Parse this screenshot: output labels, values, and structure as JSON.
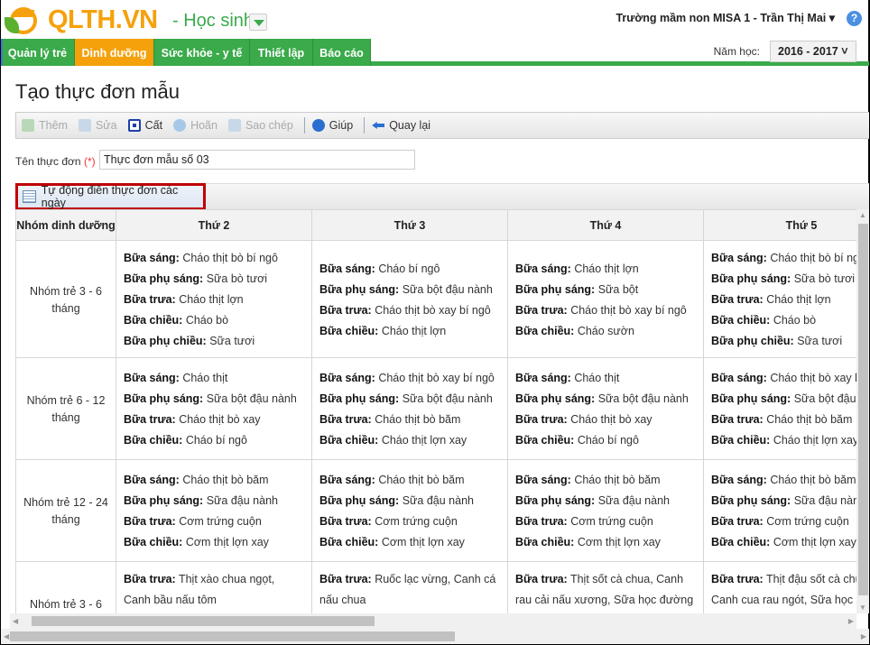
{
  "header": {
    "logo": "QLTH.VN",
    "role": "- Học sinh",
    "user": "Trường mầm non MISA 1 - Trần Thị Mai ▾",
    "help": "?"
  },
  "nav": {
    "tabs": [
      "Quản lý trẻ",
      "Dinh dưỡng",
      "Sức khỏe - y tế",
      "Thiết lập",
      "Báo cáo"
    ],
    "active": 1,
    "year_label": "Năm học:",
    "year_value": "2016 - 2017 ˅"
  },
  "page": {
    "title": "Tạo thực đơn mẫu"
  },
  "toolbar": {
    "add": "Thêm",
    "edit": "Sửa",
    "save": "Cất",
    "undo": "Hoãn",
    "copy": "Sao chép",
    "help": "Giúp",
    "back": "Quay lại"
  },
  "form": {
    "name_label": "Tên thực đơn",
    "required": "(*)",
    "name_value": "Thực đơn mẫu số 03",
    "auto_fill": "Tự động điền thực đơn các ngày"
  },
  "grid": {
    "headers": [
      "Nhóm dinh dưỡng",
      "Thứ 2",
      "Thứ 3",
      "Thứ 4",
      "Thứ 5"
    ],
    "rows": [
      {
        "group": "Nhóm trẻ 3 - 6 tháng",
        "cells": [
          [
            [
              "Bữa sáng:",
              "Cháo thịt bò bí ngô"
            ],
            [
              "Bữa phụ sáng:",
              "Sữa bò tươi"
            ],
            [
              "Bữa trưa:",
              "Cháo thịt lợn"
            ],
            [
              "Bữa chiều:",
              "Cháo bò"
            ],
            [
              "Bữa phụ chiều:",
              "Sữa tươi"
            ]
          ],
          [
            [
              "Bữa sáng:",
              "Cháo bí ngô"
            ],
            [
              "Bữa phụ sáng:",
              "Sữa bột đậu nành"
            ],
            [
              "Bữa trưa:",
              "Cháo thịt bò xay bí ngô"
            ],
            [
              "Bữa chiều:",
              "Cháo thịt lợn"
            ]
          ],
          [
            [
              "Bữa sáng:",
              "Cháo thịt lợn"
            ],
            [
              "Bữa phụ sáng:",
              "Sữa bột"
            ],
            [
              "Bữa trưa:",
              "Cháo thịt bò xay bí ngô"
            ],
            [
              "Bữa chiều:",
              "Cháo sườn"
            ]
          ],
          [
            [
              "Bữa sáng:",
              "Cháo thịt bò bí ngô"
            ],
            [
              "Bữa phụ sáng:",
              "Sữa bò tươi"
            ],
            [
              "Bữa trưa:",
              "Cháo thịt lợn"
            ],
            [
              "Bữa chiều:",
              "Cháo bò"
            ],
            [
              "Bữa phụ chiều:",
              "Sữa tươi"
            ]
          ]
        ]
      },
      {
        "group": "Nhóm trẻ 6 - 12 tháng",
        "cells": [
          [
            [
              "Bữa sáng:",
              "Cháo thịt"
            ],
            [
              "Bữa phụ sáng:",
              "Sữa bột đậu nành"
            ],
            [
              "Bữa trưa:",
              "Cháo thịt bò xay"
            ],
            [
              "Bữa chiều:",
              "Cháo bí ngô"
            ]
          ],
          [
            [
              "Bữa sáng:",
              "Cháo thịt bò xay bí ngô"
            ],
            [
              "Bữa phụ sáng:",
              "Sữa bột đậu nành"
            ],
            [
              "Bữa trưa:",
              "Cháo thịt bò băm"
            ],
            [
              "Bữa chiều:",
              "Cháo thịt lợn xay"
            ]
          ],
          [
            [
              "Bữa sáng:",
              "Cháo thịt"
            ],
            [
              "Bữa phụ sáng:",
              "Sữa bột đậu nành"
            ],
            [
              "Bữa trưa:",
              "Cháo thịt bò xay"
            ],
            [
              "Bữa chiều:",
              "Cháo bí ngô"
            ]
          ],
          [
            [
              "Bữa sáng:",
              "Cháo thịt bò xay bí ngô"
            ],
            [
              "Bữa phụ sáng:",
              "Sữa bột đậu nành"
            ],
            [
              "Bữa trưa:",
              "Cháo thịt bò băm"
            ],
            [
              "Bữa chiều:",
              "Cháo thịt lợn xay"
            ]
          ]
        ]
      },
      {
        "group": "Nhóm trẻ 12 - 24 tháng",
        "cells": [
          [
            [
              "Bữa sáng:",
              "Cháo thịt bò băm"
            ],
            [
              "Bữa phụ sáng:",
              "Sữa đậu nành"
            ],
            [
              "Bữa trưa:",
              "Cơm trứng cuộn"
            ],
            [
              "Bữa chiều:",
              "Cơm thịt lợn xay"
            ]
          ],
          [
            [
              "Bữa sáng:",
              "Cháo thịt bò băm"
            ],
            [
              "Bữa phụ sáng:",
              "Sữa đậu nành"
            ],
            [
              "Bữa trưa:",
              "Cơm trứng cuộn"
            ],
            [
              "Bữa chiều:",
              "Cơm thịt lợn xay"
            ]
          ],
          [
            [
              "Bữa sáng:",
              "Cháo thịt bò băm"
            ],
            [
              "Bữa phụ sáng:",
              "Sữa đậu nành"
            ],
            [
              "Bữa trưa:",
              "Cơm trứng cuộn"
            ],
            [
              "Bữa chiều:",
              "Cơm thịt lợn xay"
            ]
          ],
          [
            [
              "Bữa sáng:",
              "Cháo thịt bò băm"
            ],
            [
              "Bữa phụ sáng:",
              "Sữa đậu nành"
            ],
            [
              "Bữa trưa:",
              "Cơm trứng cuộn"
            ],
            [
              "Bữa chiều:",
              "Cơm thịt lợn xay"
            ]
          ]
        ]
      },
      {
        "group": "Nhóm trẻ 3 - 6",
        "cells": [
          [
            [
              "Bữa trưa:",
              "Thịt xào chua ngọt, Canh bầu nấu tôm"
            ]
          ],
          [
            [
              "Bữa trưa:",
              "Ruốc lạc vừng, Canh cá nấu chua"
            ]
          ],
          [
            [
              "Bữa trưa:",
              "Thịt sốt cà chua, Canh rau cải nấu xương, Sữa học đường"
            ]
          ],
          [
            [
              "Bữa trưa:",
              "Thịt đậu sốt cà chua, Canh cua rau ngót, Sữa học đường"
            ]
          ]
        ]
      }
    ]
  }
}
